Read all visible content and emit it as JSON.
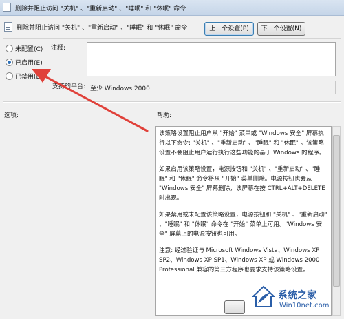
{
  "window": {
    "title": "删除并阻止访问 \"关机\" 、\"重新启动\" 、\"睡眠\" 和 \"休眠\" 命令"
  },
  "header": {
    "policy_title": "删除并阻止访问 \"关机\" 、\"重新启动\" 、\"睡眠\" 和 \"休眠\" 命令",
    "prev_button": "上一个设置(P)",
    "next_button": "下一个设置(N)"
  },
  "state": {
    "options": [
      {
        "label": "未配置(C)",
        "checked": false
      },
      {
        "label": "已启用(E)",
        "checked": true
      },
      {
        "label": "已禁用(D)",
        "checked": false
      }
    ]
  },
  "comment": {
    "label": "注释:",
    "value": ""
  },
  "platform": {
    "label": "支持的平台:",
    "value": "至少 Windows 2000"
  },
  "sections": {
    "options_label": "选项:",
    "help_label": "帮助:"
  },
  "help": {
    "paragraphs": [
      "该策略设置阻止用户从 \"开始\" 菜单或 \"Windows 安全\" 屏幕执行以下命令: \"关机\" 、\"重新启动\" 、\"睡眠\" 和 \"休眠\" 。该策略设置不会阻止用户运行执行这些功能的基于 Windows 的程序。",
      "如果启用该策略设置，电源按钮和 \"关机\" 、\"重新启动\" 、\"睡眠\" 和 \"休眠\" 命令将从 \"开始\" 菜单删除。电源按钮也会从 \"Windows 安全\" 屏幕删除，该屏幕在按 CTRL+ALT+DELETE 时出现。",
      "如果禁用或未配置该策略设置，电源按钮和 \"关机\" 、\"重新启动\" 、\"睡眠\" 和 \"休眠\" 命令在 \"开始\" 菜单上可用。\"Windows 安全\" 屏幕上的电源按钮也可用。",
      "注意: 经过验证与 Microsoft Windows Vista、Windows XP SP2、Windows XP SP1、Windows XP 或 Windows 2000 Professional 兼容的第三方程序也要求支持该策略设置。"
    ]
  },
  "watermark": {
    "brand": "系统之家",
    "url": "Win10net.com"
  },
  "colors": {
    "arrow": "#e0413a",
    "selected_radio": "#2b6fb8",
    "watermark": "#2a5ea8"
  }
}
